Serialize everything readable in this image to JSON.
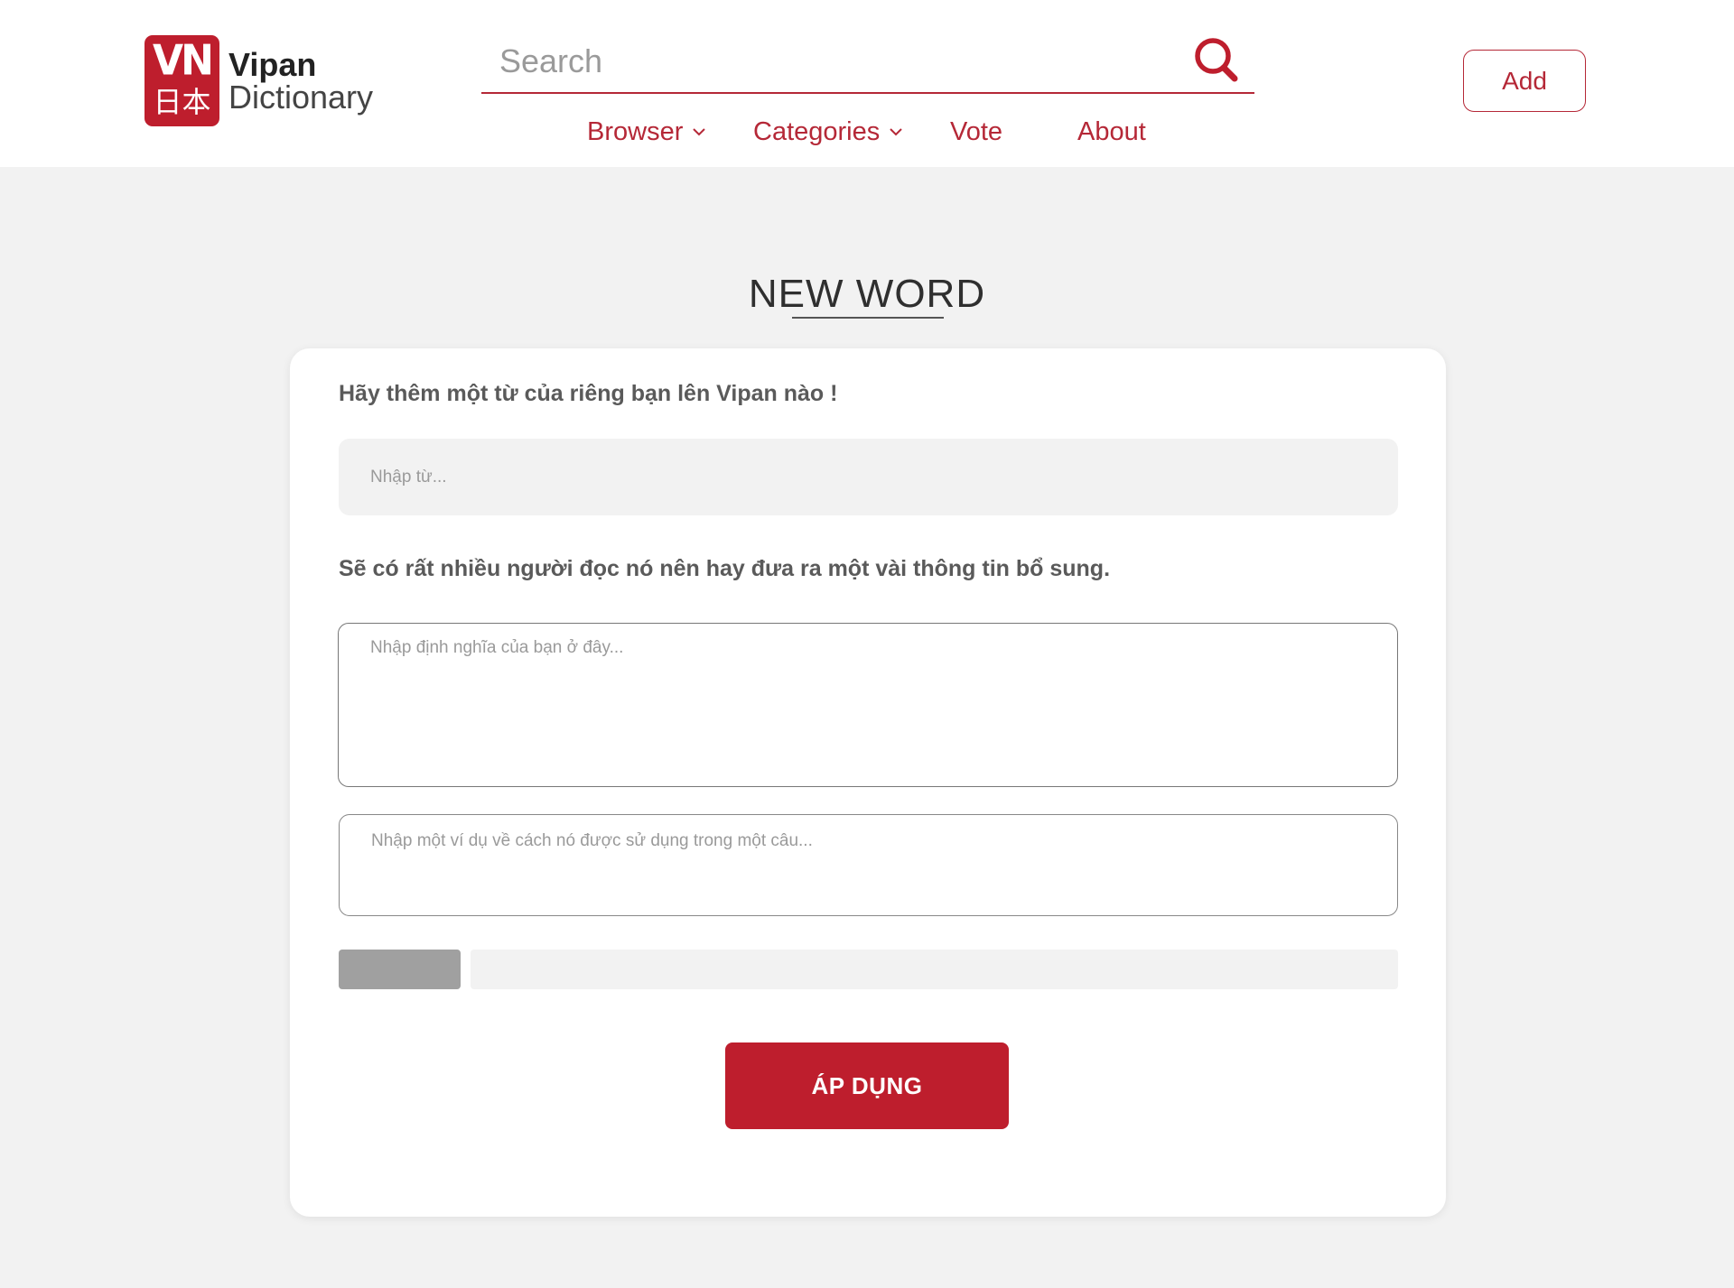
{
  "header": {
    "logo": {
      "mark": "VN",
      "kanji": "日本",
      "line1": "Vipan",
      "line2": "Dictionary"
    },
    "search": {
      "placeholder": "Search",
      "value": ""
    },
    "nav": [
      {
        "label": "Browser",
        "has_dropdown": true
      },
      {
        "label": "Categories",
        "has_dropdown": true
      },
      {
        "label": "Vote",
        "has_dropdown": false
      },
      {
        "label": "About",
        "has_dropdown": false
      }
    ],
    "add_label": "Add"
  },
  "main": {
    "title": "NEW WORD",
    "form": {
      "intro": "Hãy thêm một từ của riêng bạn lên Vipan nào !",
      "word_placeholder": "Nhập từ...",
      "hint": "Sẽ có rất nhiều người đọc nó nên hay đưa ra một vài thông tin bổ sung.",
      "definition_placeholder": "Nhập định nghĩa của bạn ở đây...",
      "example_placeholder": "Nhập một ví dụ về cách nó được sử dụng trong một câu...",
      "submit_label": "ÁP DỤNG"
    }
  },
  "colors": {
    "brand": "#be1e2d",
    "page_background": "#f2f2f2",
    "card_background": "#ffffff"
  },
  "icons": [
    "search-icon",
    "chevron-down-icon"
  ]
}
